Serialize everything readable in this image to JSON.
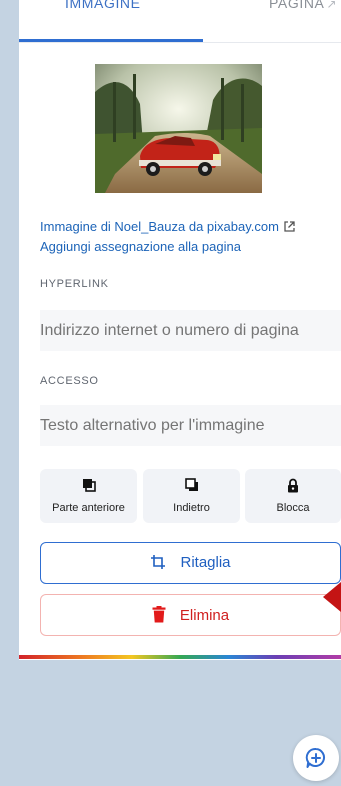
{
  "tabs": {
    "image": "IMMAGINE",
    "page": "PAGINA",
    "page_icon": "external-link-icon"
  },
  "image_panel": {
    "thumbnail_alt": "Red vintage convertible car on a tree-lined dirt road",
    "credit": "Immagine di Noel_Bauza da pixabay.com",
    "credit_icon": "external-link-icon",
    "add_attribution": "Aggiungi assegnazione alla pagina"
  },
  "hyperlink": {
    "label": "HYPERLINK",
    "placeholder": "Indirizzo internet o numero di pagina"
  },
  "access": {
    "label": "ACCESSO",
    "placeholder": "Testo alternativo per l'immagine"
  },
  "arrange": [
    {
      "label": "Parte anteriore",
      "icon": "bring-to-front-icon"
    },
    {
      "label": "Indietro",
      "icon": "send-backward-icon"
    },
    {
      "label": "Blocca",
      "icon": "lock-icon"
    }
  ],
  "actions": {
    "crop_label": "Ritaglia",
    "crop_icon": "crop-icon",
    "delete_label": "Elimina",
    "delete_icon": "trash-icon"
  },
  "colors": {
    "accent": "#2f6ed1",
    "link": "#1d64b8",
    "danger": "#d01f1f",
    "pointer": "#c41414",
    "background": "#c4d3e2"
  },
  "fab_icon": "add-comment-icon"
}
